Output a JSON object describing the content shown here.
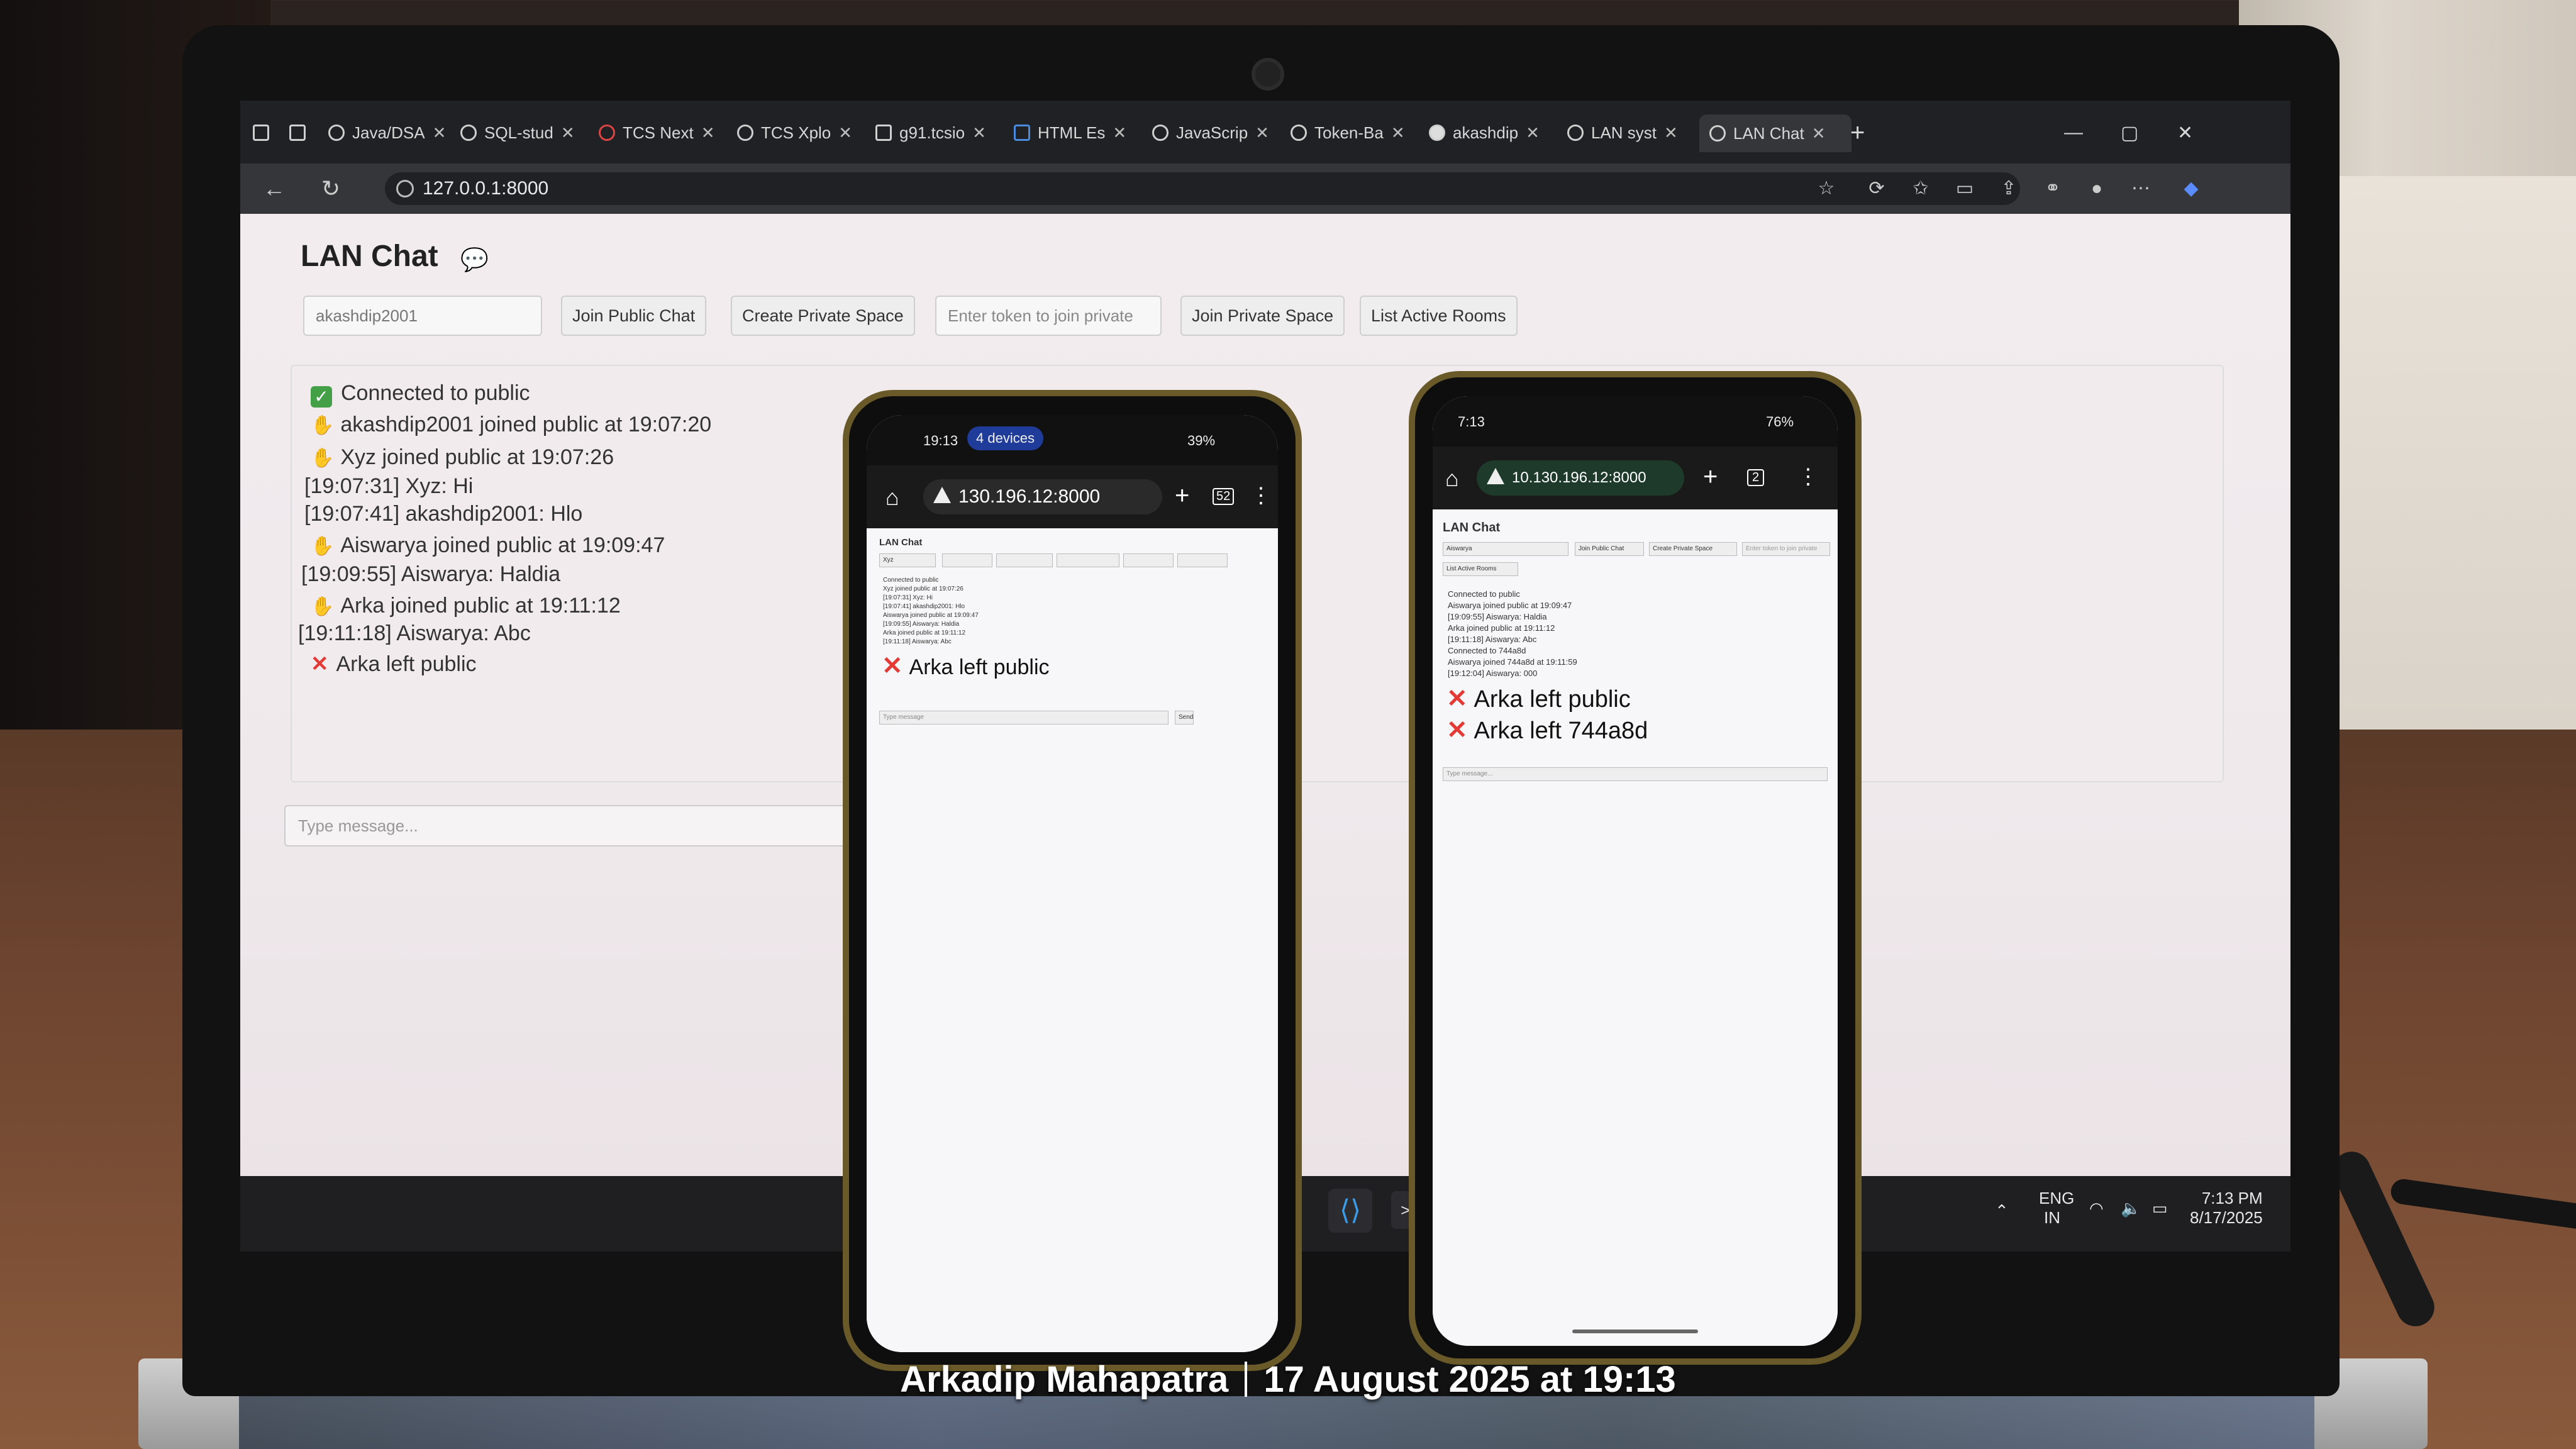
{
  "browser": {
    "tabs": [
      {
        "label": "Java/DSA"
      },
      {
        "label": "SQL-stud"
      },
      {
        "label": "TCS Next"
      },
      {
        "label": "TCS Xplo"
      },
      {
        "label": "g91.tcsio"
      },
      {
        "label": "HTML Es"
      },
      {
        "label": "JavaScrip"
      },
      {
        "label": "Token-Ba"
      },
      {
        "label": "akashdip"
      },
      {
        "label": "LAN syst"
      },
      {
        "label": "LAN Chat"
      }
    ],
    "url": "127.0.0.1:8000"
  },
  "lan_chat": {
    "title": "LAN Chat",
    "username_value": "akashdip2001",
    "join_public_label": "Join Public Chat",
    "create_private_label": "Create Private Space",
    "token_placeholder": "Enter token to join private",
    "join_private_label": "Join Private Space",
    "list_rooms_label": "List Active Rooms",
    "message_placeholder": "Type message...",
    "log": [
      {
        "kind": "status",
        "text": "Connected to public"
      },
      {
        "kind": "join",
        "text": "akashdip2001 joined public at 19:07:20"
      },
      {
        "kind": "join",
        "text": "Xyz joined public at 19:07:26"
      },
      {
        "kind": "msg",
        "text": "[19:07:31] Xyz: Hi"
      },
      {
        "kind": "msg",
        "text": "[19:07:41] akashdip2001: Hlo"
      },
      {
        "kind": "join",
        "text": "Aiswarya joined public at 19:09:47"
      },
      {
        "kind": "msg",
        "text": "[19:09:55] Aiswarya: Haldia"
      },
      {
        "kind": "join",
        "text": "Arka joined public at 19:11:12"
      },
      {
        "kind": "msg",
        "text": "[19:11:18] Aiswarya: Abc"
      },
      {
        "kind": "leave",
        "text": "Arka left public"
      }
    ]
  },
  "taskbar": {
    "lang1": "ENG",
    "lang2": "IN",
    "time": "7:13 PM",
    "date": "8/17/2025"
  },
  "phone_left": {
    "clock": "19:13",
    "pill": "4 devices",
    "battery": "39%",
    "url": "130.196.12:8000",
    "tabs_count": "52",
    "title": "LAN Chat",
    "username_value": "Xyz",
    "send_label": "Send",
    "message_placeholder": "Type message",
    "small_log": [
      "Connected to public",
      "Xyz joined public at 19:07:26",
      "[19:07:31] Xyz: Hi",
      "[19:07:41] akashdip2001: Hlo",
      "Aiswarya joined public at 19:09:47",
      "[19:09:55] Aiswarya: Haldia",
      "Arka joined public at 19:11:12",
      "[19:11:18] Aiswarya: Abc"
    ],
    "big_line": "Arka left public"
  },
  "phone_right": {
    "clock": "7:13",
    "battery": "76%",
    "url": "10.130.196.12:8000",
    "tabs_count": "2",
    "title": "LAN Chat",
    "username_value": "Aiswarya",
    "join_public_label": "Join Public Chat",
    "create_private_label": "Create Private Space",
    "token_placeholder": "Enter token to join private",
    "list_rooms_label": "List Active Rooms",
    "message_placeholder": "Type message...",
    "small_log": [
      "Connected to public",
      "Aiswarya joined public at 19:09:47",
      "[19:09:55] Aiswarya: Haldia",
      "Arka joined public at 19:11:12",
      "[19:11:18] Aiswarya: Abc",
      "Connected to 744a8d",
      "Aiswarya joined 744a8d at 19:11:59",
      "[19:12:04] Aiswarya: 000"
    ],
    "big_lines": [
      "Arka left public",
      "Arka left 744a8d"
    ]
  },
  "caption": {
    "author": "Arkadip Mahapatra",
    "datetime": "17 August 2025 at 19:13"
  },
  "colors": {
    "check_green": "#43a047",
    "cross_red": "#e53935",
    "browser_dark": "#202124"
  }
}
